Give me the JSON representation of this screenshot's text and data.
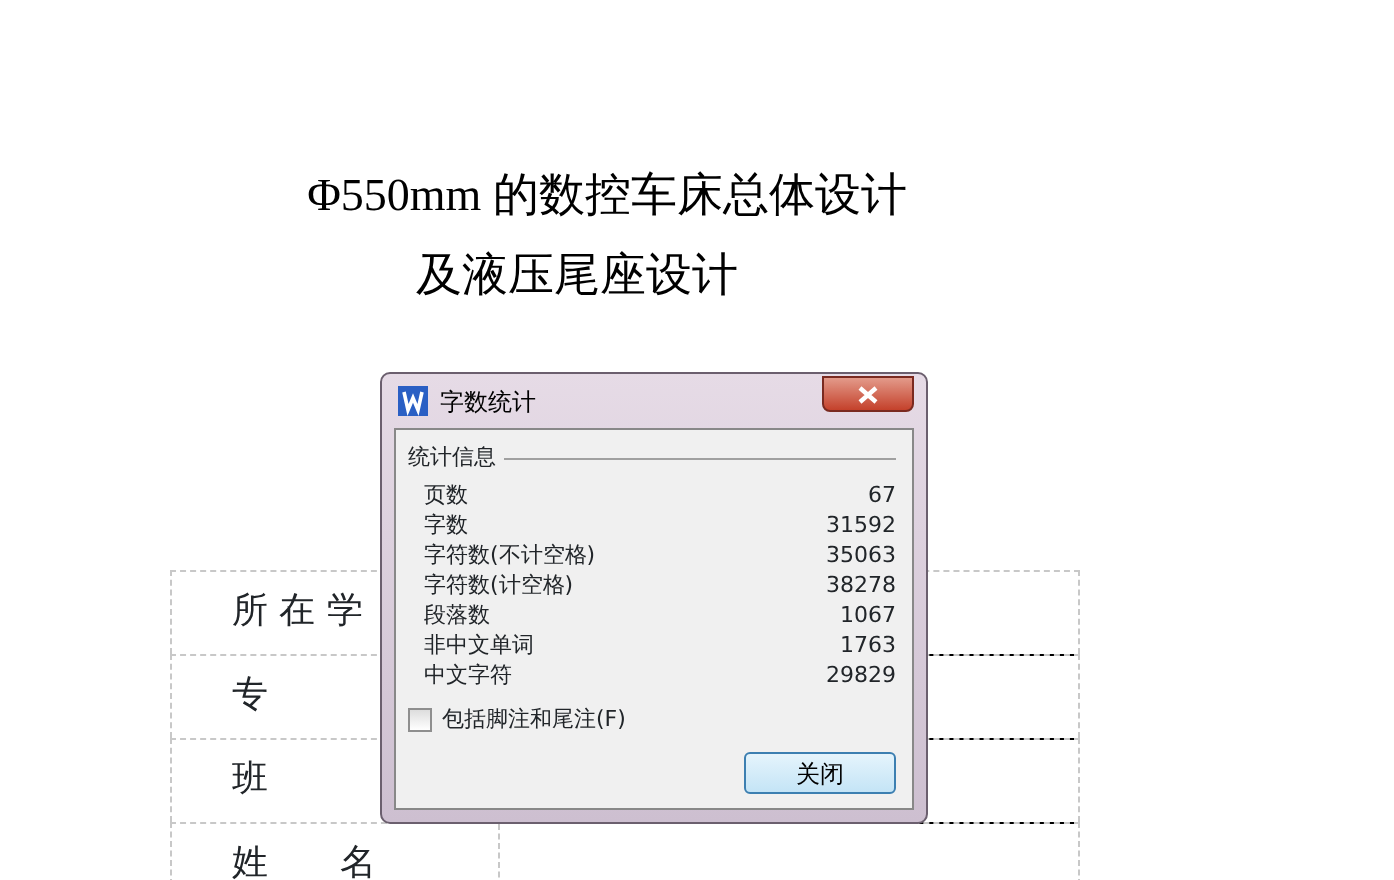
{
  "document": {
    "title_lines": [
      "Φ550mm 的数控车床总体设计",
      "及液压尾座设计"
    ],
    "table_rows": [
      {
        "label": "所 在 学"
      },
      {
        "label": "专"
      },
      {
        "label": "班"
      },
      {
        "label": "姓　　名"
      }
    ]
  },
  "dialog": {
    "title": "字数统计",
    "group": "统计信息",
    "stats": [
      {
        "label": "页数",
        "value": "67"
      },
      {
        "label": "字数",
        "value": "31592"
      },
      {
        "label": "字符数(不计空格)",
        "value": "35063"
      },
      {
        "label": "字符数(计空格)",
        "value": "38278"
      },
      {
        "label": "段落数",
        "value": "1067"
      },
      {
        "label": "非中文单词",
        "value": "1763"
      },
      {
        "label": "中文字符",
        "value": "29829"
      }
    ],
    "checkbox": {
      "label": "包括脚注和尾注(F)",
      "checked": false
    },
    "button": "关闭"
  }
}
